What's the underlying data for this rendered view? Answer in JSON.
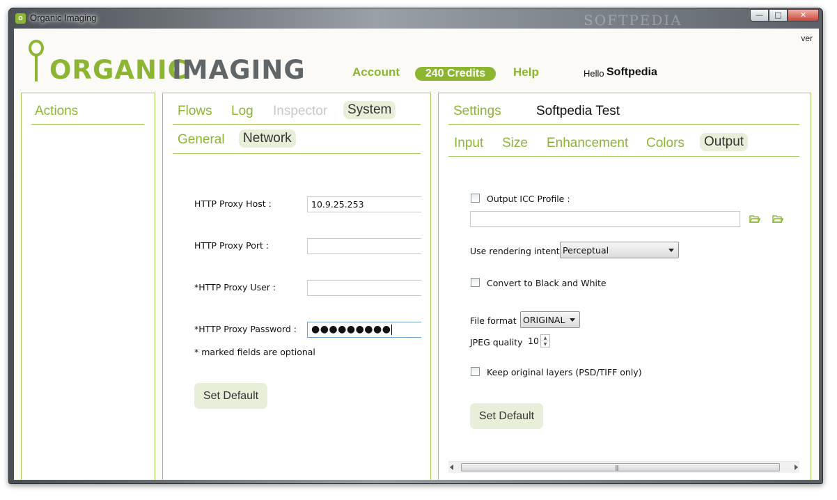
{
  "window": {
    "title": "Organic Imaging",
    "watermark": "SOFTPEDIA",
    "controls": {
      "minimize": "—",
      "maximize": "□",
      "close": "✕"
    }
  },
  "header": {
    "version_label": "ver",
    "logo": {
      "word1": "ORGANIC",
      "word2": "IMAGING"
    },
    "nav": {
      "account": "Account",
      "credits": "240 Credits",
      "help": "Help"
    },
    "hello_label": "Hello",
    "user_name": "Softpedia"
  },
  "actions_panel": {
    "title": "Actions"
  },
  "system_panel": {
    "tabs": [
      "Flows",
      "Log",
      "Inspector",
      "System"
    ],
    "selected_tab": "System",
    "subtabs": [
      "General",
      "Network"
    ],
    "selected_subtab": "Network",
    "fields": {
      "proxy_host_label": "HTTP Proxy Host :",
      "proxy_host_value": "10.9.25.253",
      "proxy_port_label": "HTTP Proxy Port :",
      "proxy_port_value": "",
      "proxy_user_label": "*HTTP Proxy User :",
      "proxy_user_value": "",
      "proxy_password_label": "*HTTP Proxy Password :",
      "proxy_password_value": "●●●●●●●●●"
    },
    "optional_note": "* marked fields are optional",
    "set_default_label": "Set Default"
  },
  "settings_panel": {
    "title": "Settings",
    "profile_name": "Softpedia Test",
    "tabs": [
      "Input",
      "Size",
      "Enhancement",
      "Colors",
      "Output"
    ],
    "selected_tab": "Output",
    "output_icc_label": "Output ICC Profile :",
    "icc_path_value": "",
    "rendering_intent_label": "Use rendering intent",
    "rendering_intent_value": "Perceptual",
    "black_white_label": "Convert to Black and White",
    "file_format_label": "File format",
    "file_format_value": "ORIGINAL",
    "jpeg_quality_label": "JPEG quality",
    "jpeg_quality_value": "10",
    "keep_layers_label": "Keep original layers (PSD/TIFF only)",
    "set_default_label": "Set Default"
  },
  "colors": {
    "accent": "#8cb532",
    "selected_tab_bg": "#e7efd8"
  },
  "icons": [
    "app-icon",
    "folder-open-icon",
    "folder-open-icon",
    "spin-up-icon",
    "spin-down-icon",
    "dropdown-arrow-icon"
  ]
}
